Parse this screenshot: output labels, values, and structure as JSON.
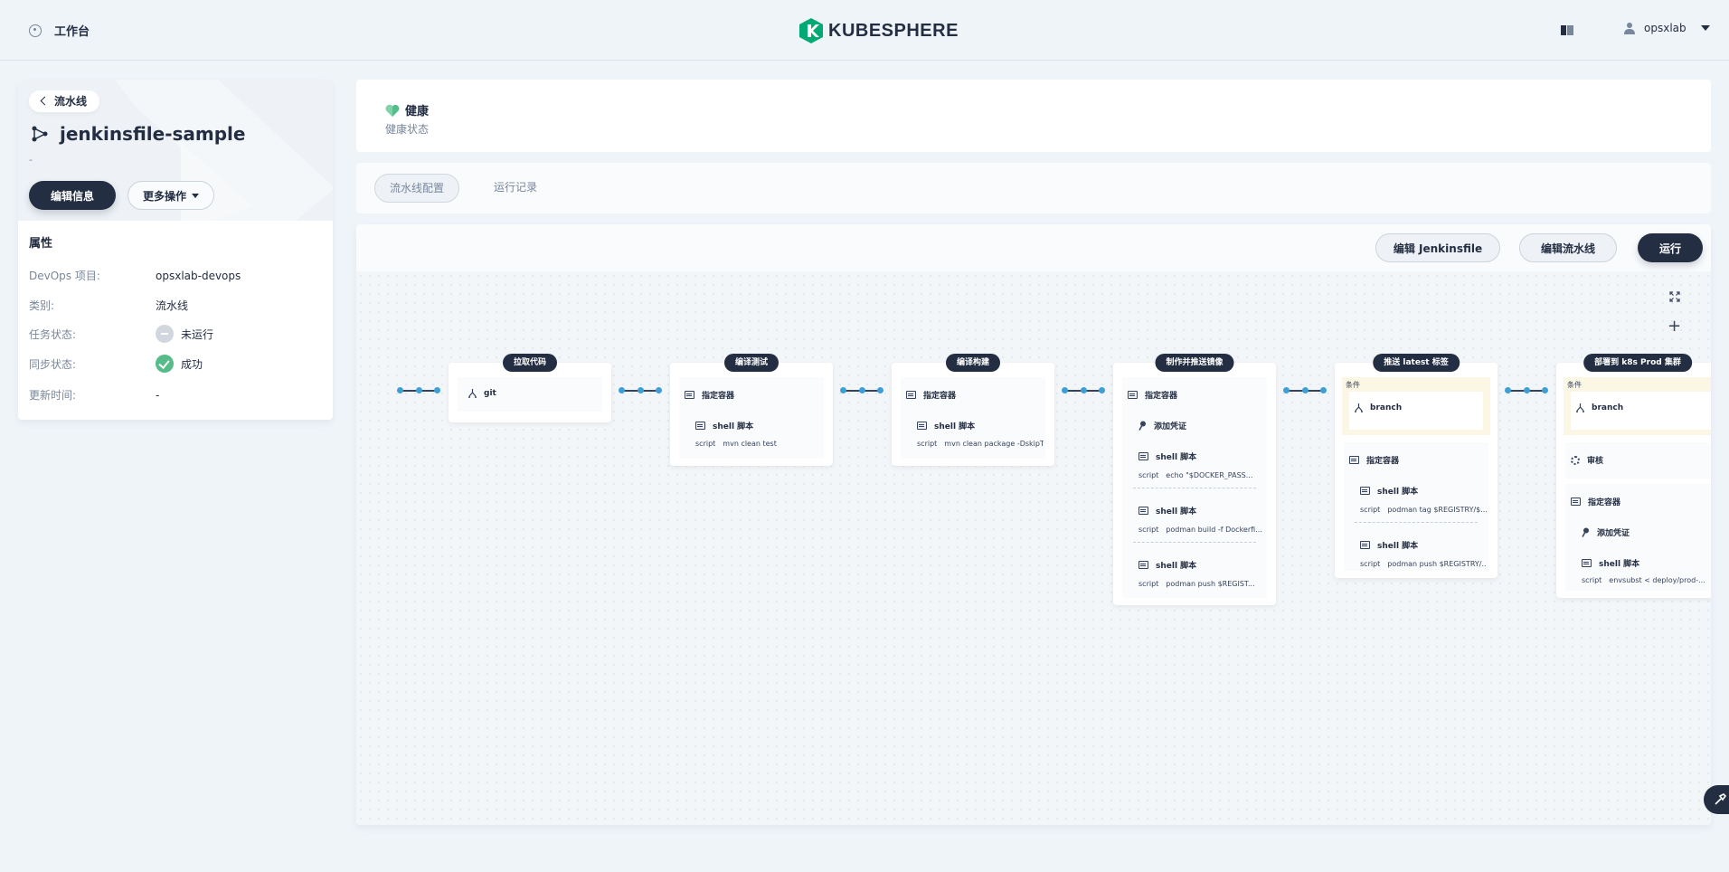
{
  "header": {
    "workbench_label": "工作台",
    "logo_text": "KUBESPHERE",
    "username": "opsxlab",
    "accent": "#00aa72"
  },
  "left": {
    "back_label": "流水线",
    "pipeline_name": "jenkinsfile-sample",
    "description": "-",
    "edit_info_label": "编辑信息",
    "more_actions_label": "更多操作",
    "attributes_title": "属性",
    "attributes": [
      {
        "key": "DevOps 项目:",
        "value": "opsxlab-devops"
      },
      {
        "key": "类别:",
        "value": "流水线"
      },
      {
        "key": "任务状态:",
        "value": "未运行"
      },
      {
        "key": "同步状态:",
        "value": "成功"
      },
      {
        "key": "更新时间:",
        "value": "-"
      }
    ]
  },
  "health": {
    "title": "健康",
    "subtitle": "健康状态",
    "color": "#55bc8a"
  },
  "tabs": [
    {
      "label": "流水线配置",
      "active": true
    },
    {
      "label": "运行记录",
      "active": false
    }
  ],
  "graph_toolbar": {
    "edit_jenkinsfile_label": "编辑 Jenkinsfile",
    "edit_pipeline_label": "编辑流水线",
    "run_label": "运行"
  },
  "canvas_controls": {
    "fullscreen": "fullscreen-icon",
    "add": "+"
  },
  "stages": [
    {
      "title": "拉取代码",
      "steps": [
        {
          "kind": "git",
          "text": "git"
        }
      ]
    },
    {
      "title": "编译测试",
      "steps": [
        {
          "kind": "container",
          "text": "指定容器"
        },
        {
          "kind": "shell",
          "text": "shell 脚本",
          "script_label": "script",
          "script": "mvn clean test"
        }
      ]
    },
    {
      "title": "编译构建",
      "steps": [
        {
          "kind": "container",
          "text": "指定容器"
        },
        {
          "kind": "shell",
          "text": "shell 脚本",
          "script_label": "script",
          "script": "mvn clean package -DskipT..."
        }
      ]
    },
    {
      "title": "制作并推送镜像",
      "steps": [
        {
          "kind": "container",
          "text": "指定容器"
        },
        {
          "kind": "credential",
          "text": "添加凭证"
        },
        {
          "kind": "shell",
          "text": "shell 脚本",
          "script_label": "script",
          "script": "echo \"$DOCKER_PASS..."
        },
        {
          "kind": "shell",
          "text": "shell 脚本",
          "script_label": "script",
          "script": "podman build -f Dockerfi..."
        },
        {
          "kind": "shell",
          "text": "shell 脚本",
          "script_label": "script",
          "script": "podman push $REGIST..."
        }
      ]
    },
    {
      "title": "推送 latest 标签",
      "condition_label": "条件",
      "condition": "branch",
      "steps": [
        {
          "kind": "container",
          "text": "指定容器"
        },
        {
          "kind": "shell",
          "text": "shell 脚本",
          "script_label": "script",
          "script": "podman tag $REGISTRY/$..."
        },
        {
          "kind": "shell",
          "text": "shell 脚本",
          "script_label": "script",
          "script": "podman push $REGISTRY/..."
        }
      ]
    },
    {
      "title": "部署到 k8s Prod 集群",
      "condition_label": "条件",
      "condition": "branch",
      "steps": [
        {
          "kind": "review",
          "text": "审核"
        },
        {
          "kind": "container",
          "text": "指定容器"
        },
        {
          "kind": "credential",
          "text": "添加凭证"
        },
        {
          "kind": "shell",
          "text": "shell 脚本",
          "script_label": "script",
          "script": "envsubst < deploy/prod-..."
        }
      ]
    }
  ]
}
